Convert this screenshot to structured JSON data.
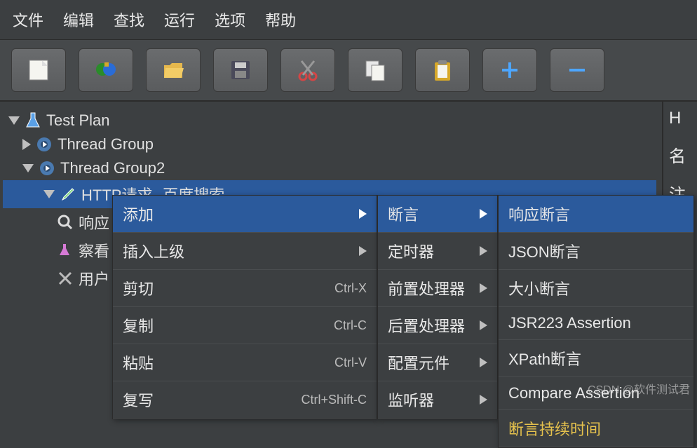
{
  "menubar": [
    "文件",
    "编辑",
    "查找",
    "运行",
    "选项",
    "帮助"
  ],
  "toolbar_icons": [
    "new-icon",
    "templates-icon",
    "open-icon",
    "save-icon",
    "cut-icon",
    "copy-icon",
    "paste-icon",
    "plus-icon",
    "minus-icon"
  ],
  "tree": {
    "root": "Test Plan",
    "tg1": "Thread Group",
    "tg2": "Thread Group2",
    "http": "HTTP请求--百度搜索",
    "n1": "响应",
    "n2": "察看",
    "n3": "用户"
  },
  "right": {
    "r1": "H",
    "r2": "名",
    "r3": "注"
  },
  "ctx1": {
    "add": "添加",
    "insert": "插入上级",
    "cut": "剪切",
    "cut_sc": "Ctrl-X",
    "copy": "复制",
    "copy_sc": "Ctrl-C",
    "paste": "粘贴",
    "paste_sc": "Ctrl-V",
    "dup": "复写",
    "dup_sc": "Ctrl+Shift-C"
  },
  "ctx2": {
    "assert": "断言",
    "timer": "定时器",
    "pre": "前置处理器",
    "post": "后置处理器",
    "config": "配置元件",
    "listener": "监听器"
  },
  "ctx3": {
    "resp": "响应断言",
    "json": "JSON断言",
    "size": "大小断言",
    "jsr": "JSR223 Assertion",
    "xpath": "XPath断言",
    "compare": "Compare Assertion",
    "dur": "断言持续时间"
  },
  "watermark": "CSDN @软件测试君"
}
